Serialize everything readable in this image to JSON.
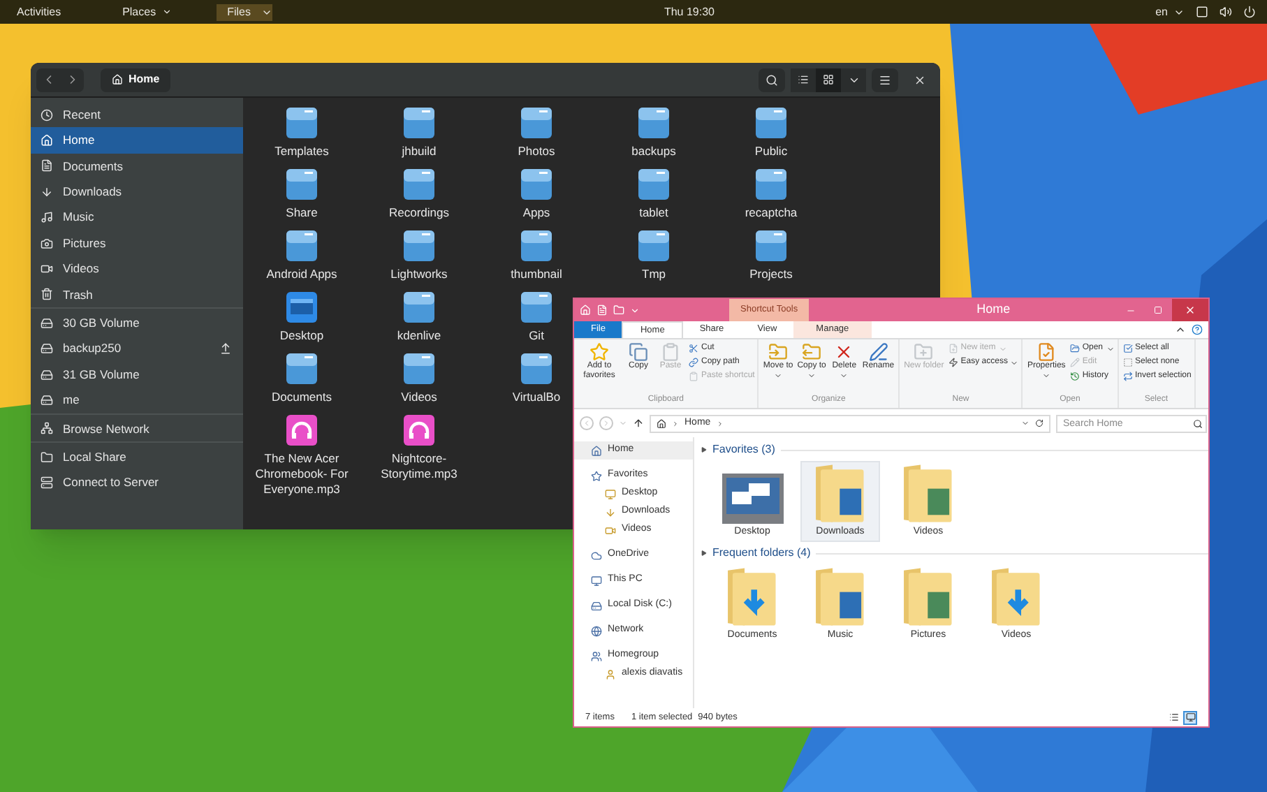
{
  "top_bar": {
    "activities": "Activities",
    "places": "Places",
    "app_menu": "Files",
    "clock": "Thu 19:30",
    "keyboard": "en"
  },
  "files_window": {
    "path": "Home",
    "view_buttons": [
      {
        "selected": false
      },
      {
        "selected": true
      }
    ],
    "sidebar": [
      {
        "items": [
          {
            "label": "Recent",
            "selected": false
          },
          {
            "label": "Home",
            "selected": true
          },
          {
            "label": "Documents",
            "selected": false
          },
          {
            "label": "Downloads",
            "selected": false
          },
          {
            "label": "Music",
            "selected": false
          },
          {
            "label": "Pictures",
            "selected": false
          },
          {
            "label": "Videos",
            "selected": false
          },
          {
            "label": "Trash",
            "selected": false
          }
        ]
      },
      {
        "items": [
          {
            "label": "30 GB Volume",
            "selected": false
          },
          {
            "label": "backup250",
            "selected": false,
            "eject": true
          },
          {
            "label": "31 GB Volume",
            "selected": false
          },
          {
            "label": "me",
            "selected": false
          }
        ]
      },
      {
        "items": [
          {
            "label": "Browse Network",
            "selected": false
          }
        ]
      },
      {
        "items": [
          {
            "label": "Local Share",
            "selected": false
          },
          {
            "label": "Connect to Server",
            "selected": false
          }
        ]
      }
    ],
    "grid": [
      [
        {
          "kind": "folder",
          "label": "Templates"
        },
        {
          "kind": "folder",
          "label": "jhbuild"
        },
        {
          "kind": "folder",
          "label": "Photos"
        },
        {
          "kind": "folder",
          "label": "backups"
        },
        {
          "kind": "folder",
          "label": "Public"
        }
      ],
      [
        {
          "kind": "folder",
          "label": "Share"
        },
        {
          "kind": "folder",
          "label": "Recordings"
        },
        {
          "kind": "folder",
          "label": "Apps"
        },
        {
          "kind": "folder",
          "label": "tablet"
        },
        {
          "kind": "folder",
          "label": "recaptcha"
        }
      ],
      [
        {
          "kind": "folder",
          "label": "Android Apps"
        },
        {
          "kind": "folder",
          "label": "Lightworks"
        },
        {
          "kind": "folder",
          "label": "thumbnail"
        },
        {
          "kind": "folder",
          "label": "Tmp"
        },
        {
          "kind": "folder",
          "label": "Projects"
        }
      ],
      [
        {
          "kind": "desktop",
          "label": "Desktop"
        },
        {
          "kind": "folder",
          "label": "kdenlive"
        },
        {
          "kind": "folder",
          "label": "Git"
        }
      ],
      [
        {
          "kind": "folder",
          "label": "Documents"
        },
        {
          "kind": "folder",
          "label": "Videos"
        },
        {
          "kind": "folder",
          "label": "VirtualBo"
        }
      ],
      [
        {
          "kind": "audio",
          "label": "The New Acer Chromebook- For Everyone.mp3"
        },
        {
          "kind": "audio",
          "label": "Nightcore-Storytime.mp3"
        }
      ]
    ]
  },
  "explorer_window": {
    "title": "Home",
    "context_tab": "Shortcut Tools",
    "tabs": [
      {
        "label": "File",
        "kind": "file",
        "selected": false
      },
      {
        "label": "Home",
        "kind": "tab",
        "selected": true
      },
      {
        "label": "Share",
        "kind": "tab",
        "selected": false
      },
      {
        "label": "View",
        "kind": "tab",
        "selected": false
      },
      {
        "label": "Manage",
        "kind": "context",
        "selected": false
      }
    ],
    "ribbon": [
      {
        "name": "Clipboard",
        "buttons": [
          {
            "label": "Add to favorites",
            "kind": "large",
            "disabled": false
          },
          {
            "label": "Copy",
            "kind": "large",
            "disabled": false
          },
          {
            "label": "Paste",
            "kind": "large",
            "disabled": true
          },
          {
            "label": "Cut",
            "kind": "small",
            "disabled": false
          },
          {
            "label": "Copy path",
            "kind": "small",
            "disabled": false
          },
          {
            "label": "Paste shortcut",
            "kind": "small",
            "disabled": true
          }
        ]
      },
      {
        "name": "Organize",
        "buttons": [
          {
            "label": "Move to",
            "kind": "large",
            "disabled": false,
            "menu": true
          },
          {
            "label": "Copy to",
            "kind": "large",
            "disabled": false,
            "menu": true
          },
          {
            "label": "Delete",
            "kind": "large",
            "disabled": false,
            "menu": true
          },
          {
            "label": "Rename",
            "kind": "large",
            "disabled": false
          }
        ]
      },
      {
        "name": "New",
        "buttons": [
          {
            "label": "New folder",
            "kind": "large",
            "disabled": true
          },
          {
            "label": "New item",
            "kind": "small",
            "disabled": true,
            "menu": true
          },
          {
            "label": "Easy access",
            "kind": "small",
            "disabled": false,
            "menu": true
          }
        ]
      },
      {
        "name": "Open",
        "buttons": [
          {
            "label": "Properties",
            "kind": "large",
            "disabled": false,
            "menu": true
          },
          {
            "label": "Open",
            "kind": "small",
            "disabled": false,
            "menu": true
          },
          {
            "label": "Edit",
            "kind": "small",
            "disabled": true
          },
          {
            "label": "History",
            "kind": "small",
            "disabled": false
          }
        ]
      },
      {
        "name": "Select",
        "buttons": [
          {
            "label": "Select all",
            "kind": "small",
            "disabled": false
          },
          {
            "label": "Select none",
            "kind": "small",
            "disabled": false
          },
          {
            "label": "Invert selection",
            "kind": "small",
            "disabled": false
          }
        ]
      }
    ],
    "address": {
      "crumb": "Home",
      "search_placeholder": "Search Home"
    },
    "nav": [
      {
        "label": "Home",
        "selected": true
      },
      {
        "label": "Favorites",
        "selected": false,
        "children": [
          {
            "label": "Desktop",
            "selected": false
          },
          {
            "label": "Downloads",
            "selected": false
          },
          {
            "label": "Videos",
            "selected": false
          }
        ]
      },
      {
        "label": "OneDrive",
        "selected": false
      },
      {
        "label": "This PC",
        "selected": false
      },
      {
        "label": "Local Disk (C:)",
        "selected": false
      },
      {
        "label": "Network",
        "selected": false
      },
      {
        "label": "Homegroup",
        "selected": false,
        "children": [
          {
            "label": "alexis diavatis",
            "selected": false
          }
        ]
      }
    ],
    "sections": [
      {
        "title": "Favorites (3)",
        "items": [
          {
            "kind": "desktop",
            "label": "Desktop",
            "selected": false
          },
          {
            "kind": "folder",
            "label": "Downloads",
            "selected": true
          },
          {
            "kind": "folder",
            "label": "Videos",
            "selected": false
          }
        ]
      },
      {
        "title": "Frequent folders (4)",
        "items": [
          {
            "kind": "folder",
            "label": "Documents",
            "selected": false
          },
          {
            "kind": "folder",
            "label": "Music",
            "selected": false
          },
          {
            "kind": "folder",
            "label": "Pictures",
            "selected": false
          },
          {
            "kind": "folder",
            "label": "Videos",
            "selected": false
          }
        ]
      }
    ],
    "status": {
      "count": "7 items",
      "selection": "1 item selected",
      "size": "940 bytes",
      "view_buttons": [
        {
          "selected": false
        },
        {
          "selected": true
        }
      ]
    }
  }
}
